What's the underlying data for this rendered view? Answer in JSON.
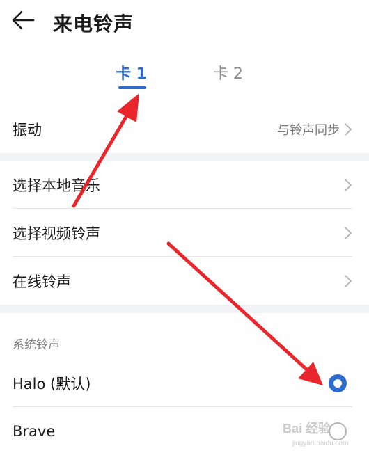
{
  "header": {
    "title": "来电铃声",
    "back_icon": "arrow-left-icon"
  },
  "tabs": [
    {
      "label": "卡 1",
      "active": true
    },
    {
      "label": "卡 2",
      "active": false
    }
  ],
  "vibration": {
    "label": "振动",
    "value": "与铃声同步"
  },
  "ringtone_options": [
    {
      "label": "选择本地音乐"
    },
    {
      "label": "选择视频铃声"
    },
    {
      "label": "在线铃声"
    }
  ],
  "system_ringtones": {
    "section_label": "系统铃声",
    "items": [
      {
        "label": "Halo (默认)",
        "selected": true
      },
      {
        "label": "Brave",
        "selected": false
      }
    ]
  },
  "watermark": {
    "text": "Bai 经验",
    "url_text": "jingyan.baidu.com"
  },
  "colors": {
    "accent": "#2d6ccf",
    "annotation_arrow": "#e8262b",
    "section_gap": "#f1f3f5"
  },
  "annotations": [
    {
      "icon": "red-arrow-icon",
      "target": "tab-card-1"
    },
    {
      "icon": "red-arrow-icon",
      "target": "radio-halo"
    }
  ]
}
